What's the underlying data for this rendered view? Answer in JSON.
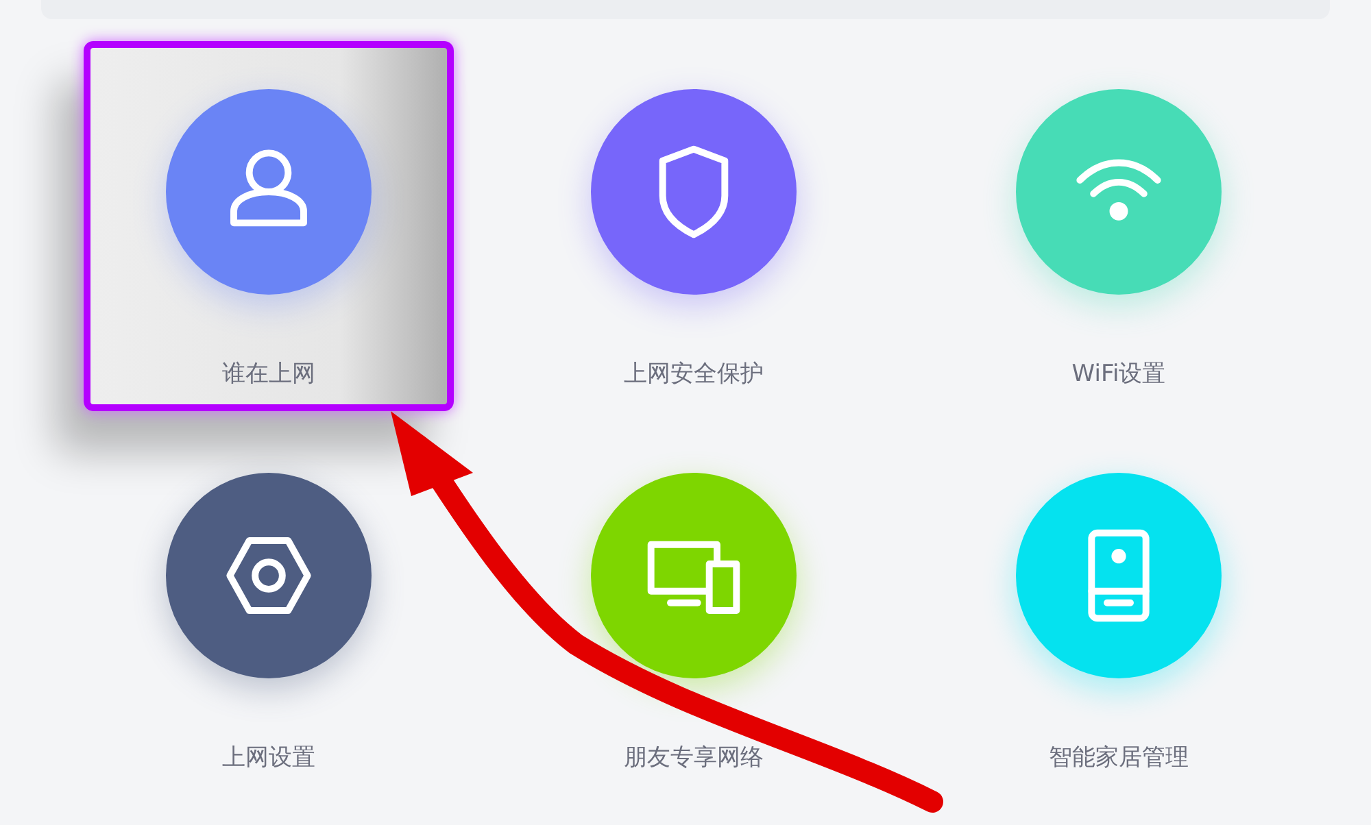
{
  "tiles": [
    {
      "label": "谁在上网",
      "kind": "user",
      "color": "#6a84f5",
      "highlighted": true
    },
    {
      "label": "上网安全保护",
      "kind": "shield",
      "color": "#7766fa",
      "highlighted": false
    },
    {
      "label": "WiFi设置",
      "kind": "wifi",
      "color": "#47dcb6",
      "highlighted": false
    },
    {
      "label": "上网设置",
      "kind": "nut",
      "color": "#4e5d82",
      "highlighted": false
    },
    {
      "label": "朋友专享网络",
      "kind": "devices",
      "color": "#7ed600",
      "highlighted": false
    },
    {
      "label": "智能家居管理",
      "kind": "device",
      "color": "#05e2ef",
      "highlighted": false
    }
  ]
}
